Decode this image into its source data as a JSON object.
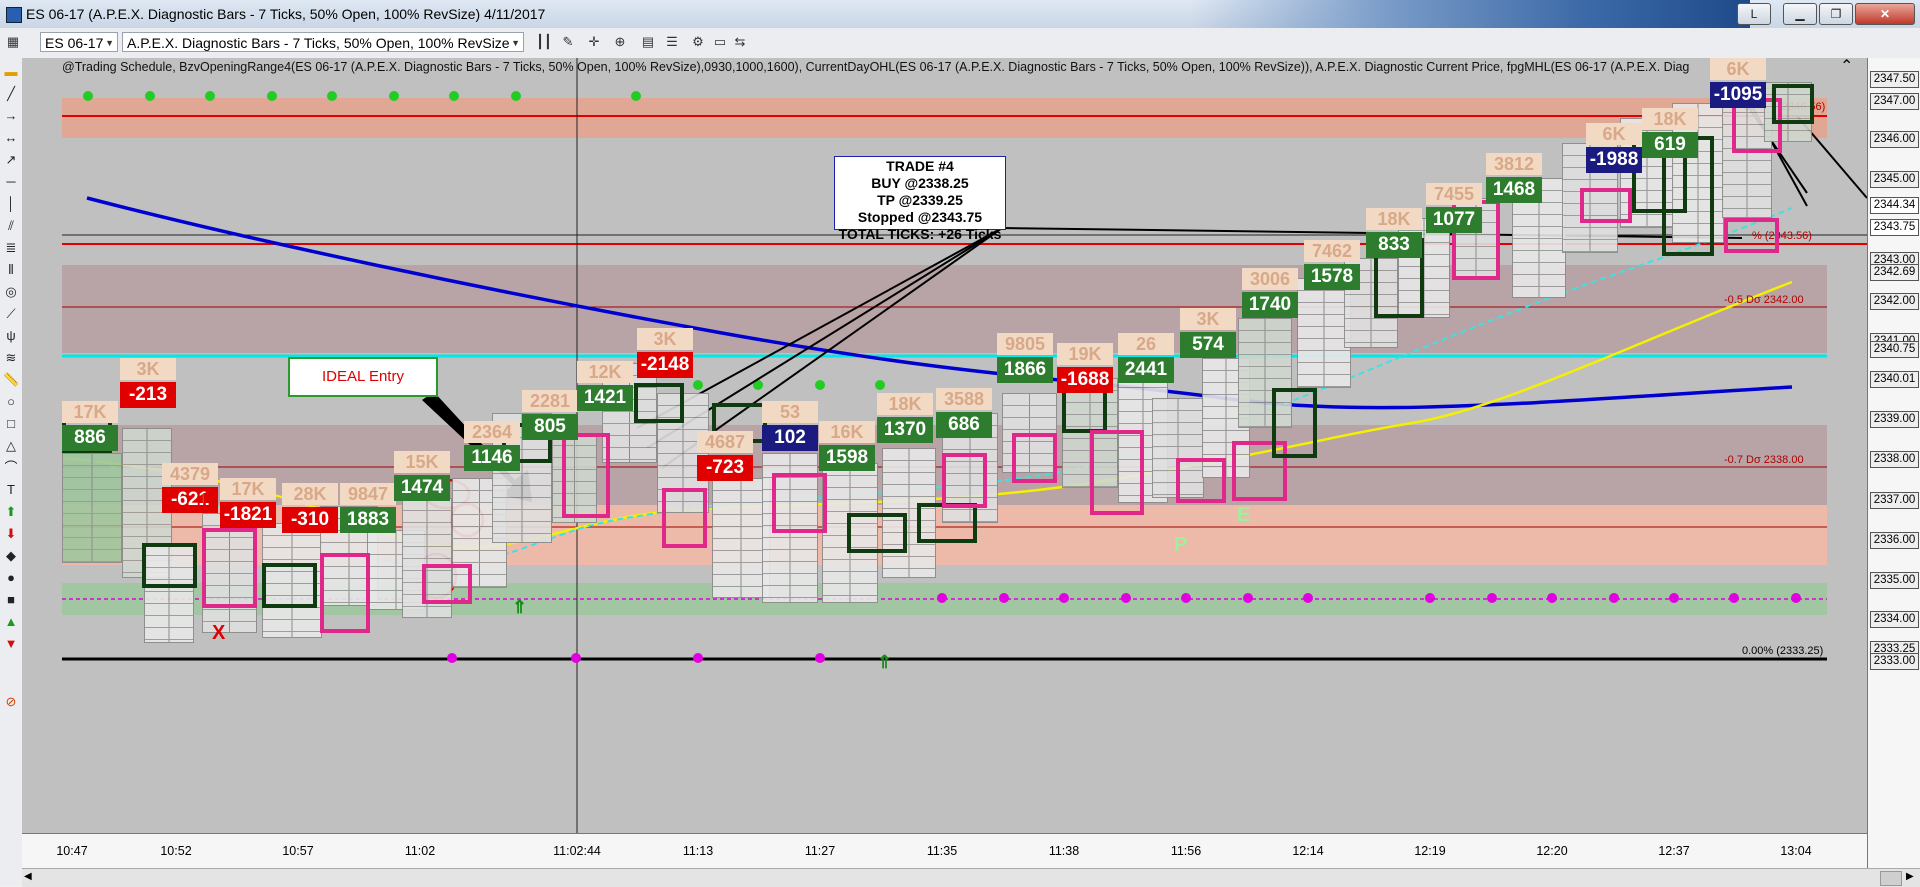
{
  "window": {
    "title": "ES 06-17 (A.P.E.X. Diagnostic Bars - 7 Ticks, 50% Open, 100% RevSize)  4/11/2017",
    "min_label": "L"
  },
  "toolbar": {
    "instrument": "ES 06-17",
    "chart_type": "A.P.E.X. Diagnostic Bars - 7 Ticks, 50% Open, 100% RevSize"
  },
  "indicator_line": "@Trading Schedule, BzvOpeningRange4(ES 06-17 (A.P.E.X. Diagnostic Bars - 7 Ticks, 50% Open, 100% RevSize),0930,1000,1600), CurrentDayOHL(ES 06-17 (A.P.E.X. Diagnostic Bars - 7 Ticks, 50% Open, 100% RevSize)), A.P.E.X. Diagnostic Current Price, fpgMHL(ES 06-17 (A.P.E.X. Diag",
  "colors": {
    "chart_bg": "#c0c0c0",
    "red_line": "#e00000",
    "blue_ma": "#0000d0",
    "yellow_ma": "#f5f000",
    "cyan_line": "#00e0e0",
    "buy_green": "#2bb52b",
    "sell_red": "#e00000"
  },
  "y_axis": {
    "labels": [
      "2347.50",
      "2347.00",
      "2346.00",
      "2345.00",
      "2344.34",
      "2343.75",
      "2343.00",
      "2342.69",
      "2342.00",
      "2341.00",
      "2340.75",
      "2340.01",
      "2339.00",
      "2338.00",
      "2337.00",
      "2336.00",
      "2335.00",
      "2334.00",
      "2333.25",
      "2333.00"
    ]
  },
  "x_axis": {
    "labels": [
      "10:47",
      "10:52",
      "10:57",
      "11:02",
      "11:02:44",
      "11:13",
      "11:27",
      "11:35",
      "11:38",
      "11:56",
      "12:14",
      "12:19",
      "12:20",
      "12:37",
      "13:04"
    ]
  },
  "levels": {
    "fib_pct": "50.0% (2346.56)",
    "fib_bottom": "0.00% (2333.25)",
    "dev_1": "-0.5 Dσ 2342.00",
    "dev_2": "-0.7 Dσ 2338.00",
    "fib_mid": "% (2343.56)"
  },
  "trade_box": {
    "line1": "TRADE #4",
    "line2": "BUY @2338.25",
    "line3": "TP @2339.25",
    "line4": "Stopped @2343.75",
    "line5": "TOTAL TICKS: +26 Ticks"
  },
  "ideal_entry": "IDEAL Entry",
  "markers": {
    "x_mark": "X",
    "p_mark": "P",
    "e_mark": "E",
    "f_mark": "F"
  },
  "badges": [
    {
      "top": "17K",
      "bottom": "886",
      "bg": "#2e7d2e"
    },
    {
      "top": "3K",
      "bottom": "-213",
      "bg": "#e00000"
    },
    {
      "top": "4379",
      "bottom": "-621",
      "bg": "#e00000"
    },
    {
      "top": "17K",
      "bottom": "-1821",
      "bg": "#e00000"
    },
    {
      "top": "28K",
      "bottom": "-310",
      "bg": "#e00000"
    },
    {
      "top": "9847",
      "bottom": "1883",
      "bg": "#2e7d2e"
    },
    {
      "top": "15K",
      "bottom": "1474",
      "bg": "#2e7d2e"
    },
    {
      "top": "2364",
      "bottom": "1146",
      "bg": "#2e7d2e"
    },
    {
      "top": "2281",
      "bottom": "805",
      "bg": "#2e7d2e"
    },
    {
      "top": "12K",
      "bottom": "1421",
      "bg": "#2e7d2e"
    },
    {
      "top": "3K",
      "bottom": "-2148",
      "bg": "#e00000"
    },
    {
      "top": "4687",
      "bottom": "-723",
      "bg": "#e00000"
    },
    {
      "top": "53",
      "bottom": "102",
      "bg": "#1a1a80"
    },
    {
      "top": "16K",
      "bottom": "1598",
      "bg": "#2e7d2e"
    },
    {
      "top": "18K",
      "bottom": "1370",
      "bg": "#2e7d2e"
    },
    {
      "top": "3588",
      "bottom": "686",
      "bg": "#2e7d2e"
    },
    {
      "top": "9805",
      "bottom": "1866",
      "bg": "#2e7d2e"
    },
    {
      "top": "19K",
      "bottom": "-1688",
      "bg": "#e00000"
    },
    {
      "top": "26",
      "bottom": "2441",
      "bg": "#2e7d2e"
    },
    {
      "top": "3K",
      "bottom": "574",
      "bg": "#2e7d2e"
    },
    {
      "top": "3006",
      "bottom": "1740",
      "bg": "#2e7d2e"
    },
    {
      "top": "7462",
      "bottom": "1578",
      "bg": "#2e7d2e"
    },
    {
      "top": "18K",
      "bottom": "833",
      "bg": "#2e7d2e"
    },
    {
      "top": "7455",
      "bottom": "1077",
      "bg": "#2e7d2e"
    },
    {
      "top": "3812",
      "bottom": "1468",
      "bg": "#2e7d2e"
    },
    {
      "top": "6K",
      "bottom": "-1988",
      "bg": "#1a1a80"
    },
    {
      "top": "18K",
      "bottom": "619",
      "bg": "#2e7d2e"
    },
    {
      "top": "6K",
      "bottom": "-1095",
      "bg": "#1a1a80"
    }
  ]
}
